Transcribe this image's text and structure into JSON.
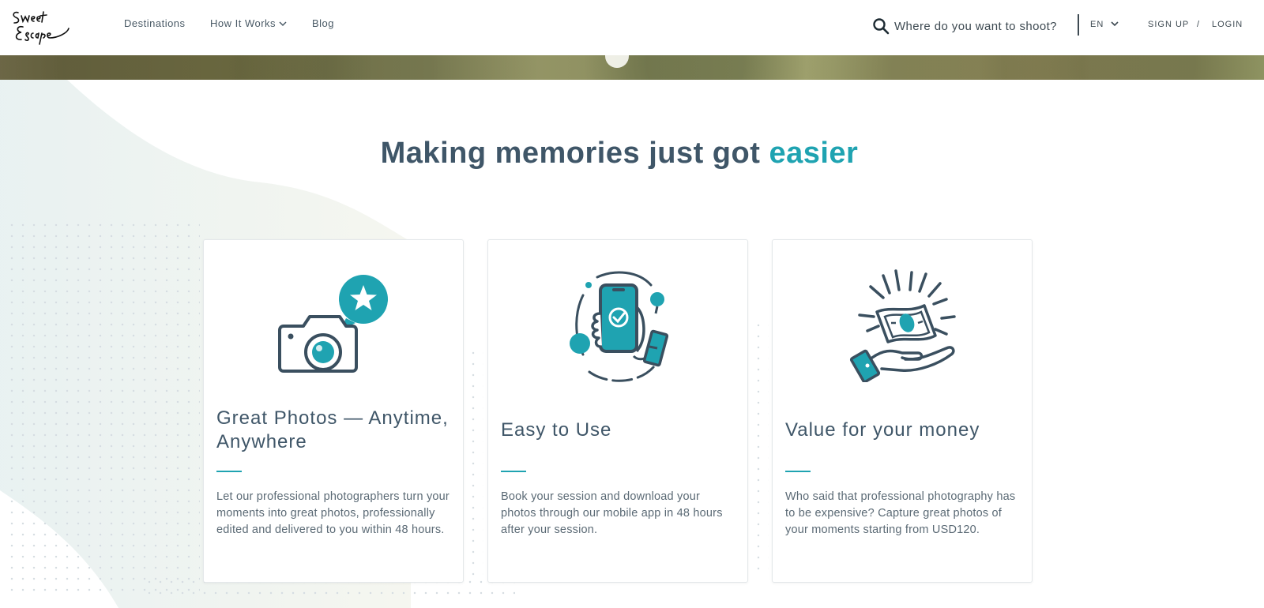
{
  "brand": {
    "logo_text": "Sweet Escape",
    "accent_color": "#1fa3b1",
    "dark_color": "#3f5668"
  },
  "nav": {
    "destinations": "Destinations",
    "how_it_works": "How It Works",
    "blog": "Blog"
  },
  "search": {
    "placeholder": "Where do you want to shoot?",
    "icon": "search-icon"
  },
  "language": {
    "selected": "EN",
    "icon": "chevron-down-icon"
  },
  "auth": {
    "sign_up": "SIGN UP",
    "separator": "/",
    "login": "LOGIN"
  },
  "section": {
    "title_prefix": "Making memories just got",
    "title_accent": "easier"
  },
  "features": [
    {
      "icon": "camera-star-icon",
      "title": "Great Photos — Anytime, Anywhere",
      "text": "Let our professional photographers turn your moments into great photos, professionally edited and delivered to you within 48 hours."
    },
    {
      "icon": "phone-check-icon",
      "title": "Easy to Use",
      "text": "Book your session and download your photos through our mobile app in 48 hours after your session."
    },
    {
      "icon": "money-hand-icon",
      "title": "Value for your money",
      "text": "Who said that professional photography has to be expensive? Capture great photos of your moments starting from USD120."
    }
  ]
}
